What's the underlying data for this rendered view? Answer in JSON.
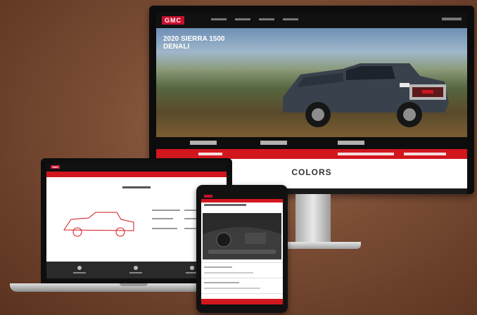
{
  "desktop": {
    "brand_logo": "GMC",
    "hero_title_line1": "2020 SIERRA 1500",
    "hero_title_line2": "DENALI",
    "section_heading": "COLORS"
  },
  "laptop": {
    "brand_logo": "GMC"
  },
  "colors": {
    "brand_red": "#d2161e",
    "nav_black": "#111111",
    "background_brown": "#7a4c34"
  }
}
